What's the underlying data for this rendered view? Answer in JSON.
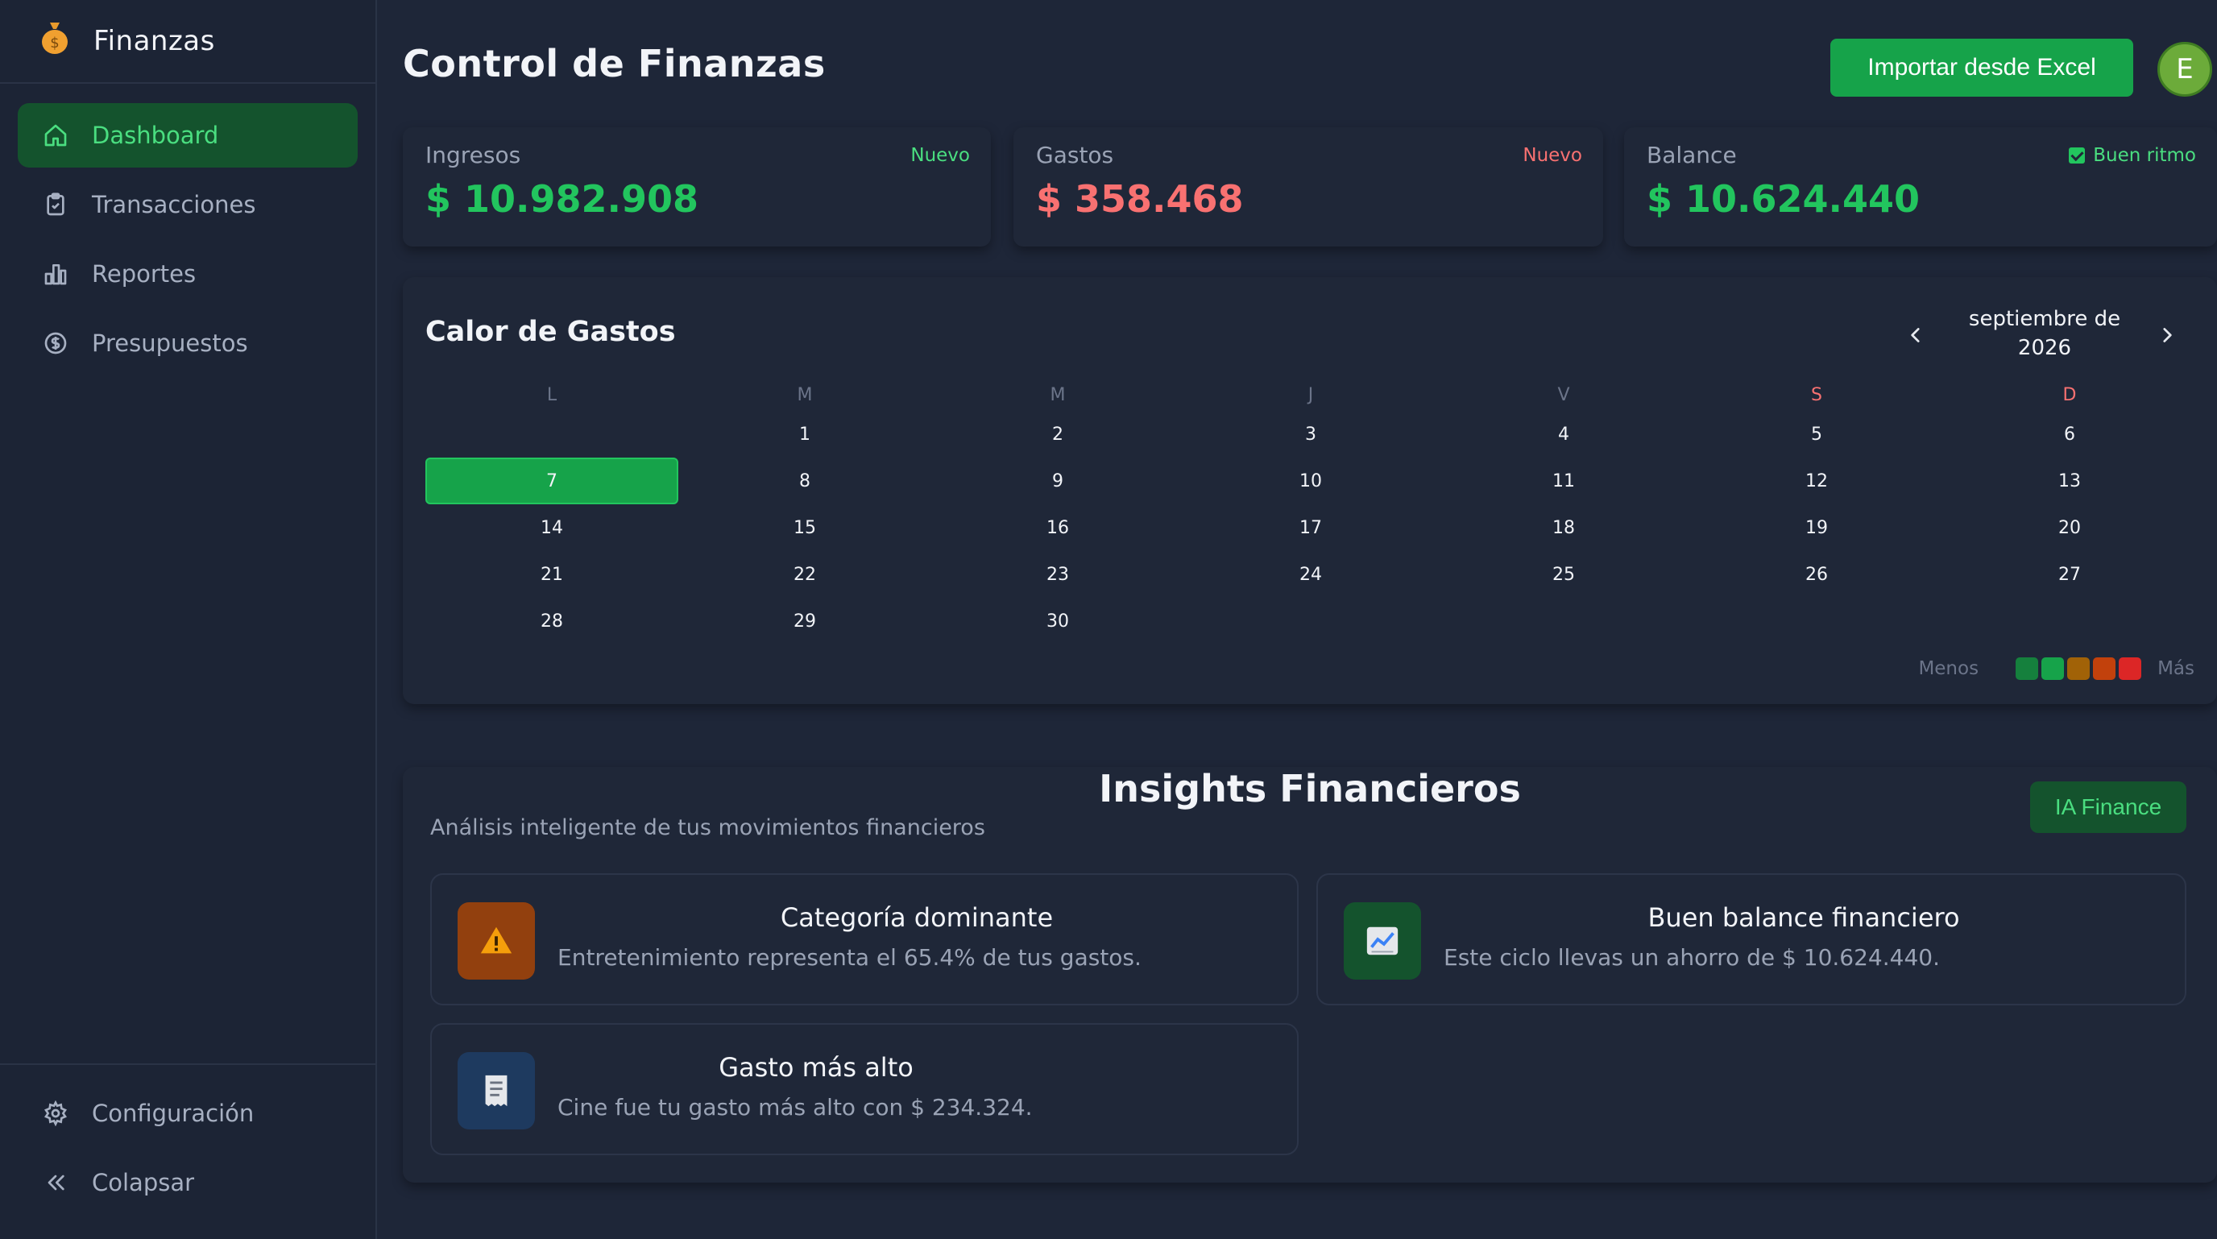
{
  "brand": {
    "name": "Finanzas",
    "icon": "money-bag-icon"
  },
  "sidebar": {
    "items": [
      {
        "label": "Dashboard",
        "icon": "home-icon",
        "active": true
      },
      {
        "label": "Transacciones",
        "icon": "clipboard-icon",
        "active": false
      },
      {
        "label": "Reportes",
        "icon": "bar-chart-icon",
        "active": false
      },
      {
        "label": "Presupuestos",
        "icon": "dollar-circle-icon",
        "active": false
      }
    ],
    "bottom": [
      {
        "label": "Configuración",
        "icon": "gear-icon"
      },
      {
        "label": "Colapsar",
        "icon": "double-chevron-left-icon"
      }
    ]
  },
  "header": {
    "title": "Control de Finanzas",
    "import_label": "Importar desde Excel",
    "avatar_initial": "E"
  },
  "stats": [
    {
      "label": "Ingresos",
      "value": "$ 10.982.908",
      "badge": "Nuevo",
      "color": "#22c55e"
    },
    {
      "label": "Gastos",
      "value": "$ 358.468",
      "badge": "Nuevo",
      "color": "#f87171"
    },
    {
      "label": "Balance",
      "value": "$ 10.624.440",
      "badge": "Buen ritmo",
      "color": "#22c55e"
    }
  ],
  "calendar": {
    "title": "Calor de Gastos",
    "month_line1": "septiembre de",
    "month_line2": "2026",
    "weekdays": [
      "L",
      "M",
      "M",
      "J",
      "V",
      "S",
      "D"
    ],
    "weeks": [
      [
        "",
        "1",
        "2",
        "3",
        "4",
        "5",
        "6"
      ],
      [
        "7",
        "8",
        "9",
        "10",
        "11",
        "12",
        "13"
      ],
      [
        "14",
        "15",
        "16",
        "17",
        "18",
        "19",
        "20"
      ],
      [
        "21",
        "22",
        "23",
        "24",
        "25",
        "26",
        "27"
      ],
      [
        "28",
        "29",
        "30",
        "",
        "",
        "",
        ""
      ]
    ],
    "today": "7",
    "legend_less": "Menos",
    "legend_more": "Más",
    "legend_colors": [
      "#15803d",
      "#16a34a",
      "#a16207",
      "#c2410c",
      "#dc2626"
    ]
  },
  "insights": {
    "title": "Insights Financieros",
    "subtitle": "Análisis inteligente de tus movimientos financieros",
    "ai_label": "IA Finance",
    "cards": [
      {
        "title": "Categoría dominante",
        "text": "Entretenimiento representa el 65.4% de tus gastos.",
        "icon": "warning-icon",
        "icon_bg": "#92400e"
      },
      {
        "title": "Buen balance financiero",
        "text": "Este ciclo llevas un ahorro de $ 10.624.440.",
        "icon": "trending-up-chart-icon",
        "icon_bg": "#14532d"
      },
      {
        "title": "Gasto más alto",
        "text": "Cine fue tu gasto más alto con $ 234.324.",
        "icon": "receipt-icon",
        "icon_bg": "#1e3a5f"
      }
    ]
  }
}
